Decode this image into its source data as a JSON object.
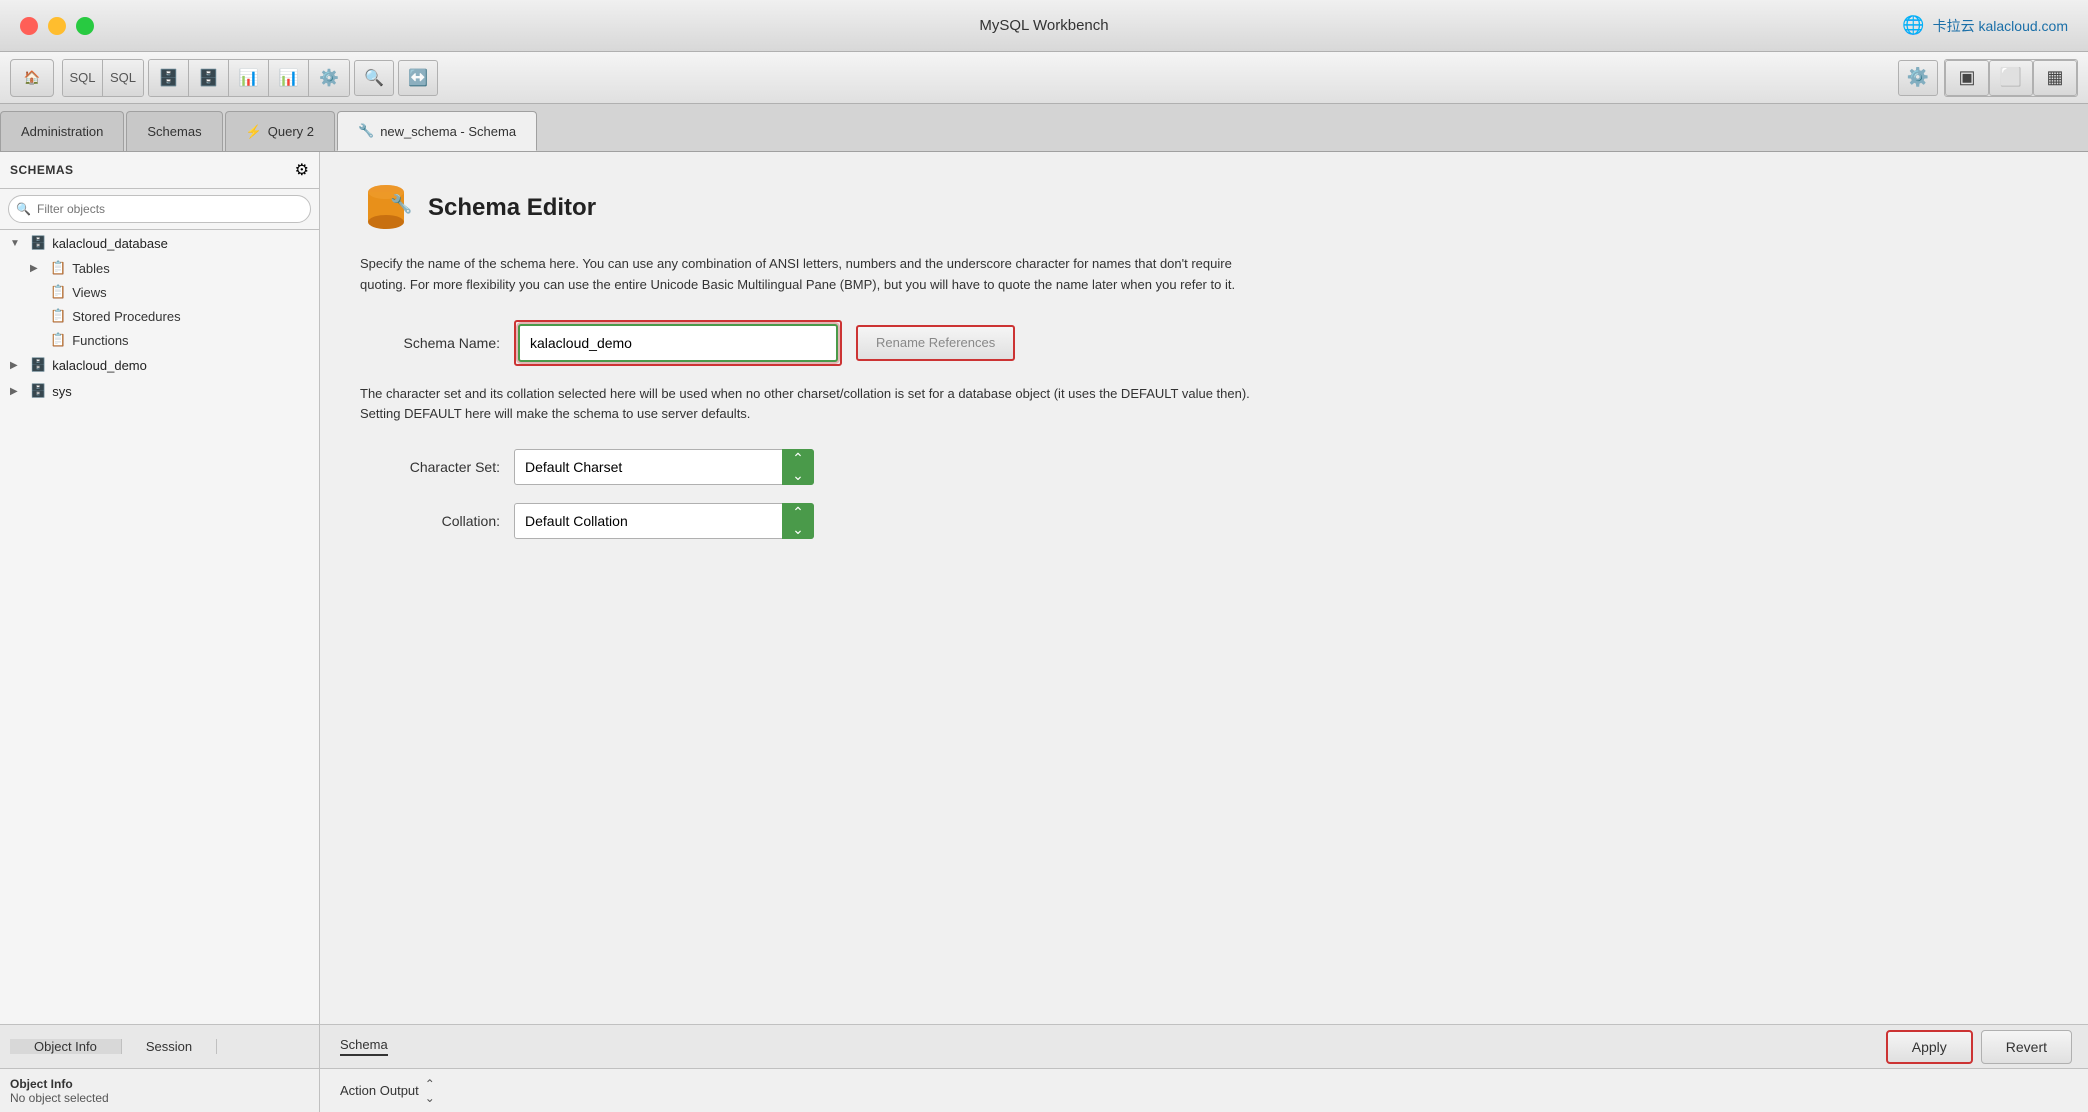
{
  "window": {
    "title": "MySQL Workbench",
    "brand": "卡拉云 kalacloud.com"
  },
  "tabs": {
    "items": [
      {
        "label": "Administration",
        "active": false
      },
      {
        "label": "Schemas",
        "active": false
      },
      {
        "label": "Query 2",
        "active": false,
        "icon": "⚡"
      },
      {
        "label": "new_schema - Schema",
        "active": true,
        "icon": "🔧"
      }
    ]
  },
  "sidebar": {
    "title": "SCHEMAS",
    "filter_placeholder": "Filter objects",
    "tree": [
      {
        "name": "kalacloud_database",
        "expanded": true,
        "children": [
          {
            "name": "Tables",
            "icon": "📋"
          },
          {
            "name": "Views",
            "icon": "📋"
          },
          {
            "name": "Stored Procedures",
            "icon": "📋"
          },
          {
            "name": "Functions",
            "icon": "📋"
          }
        ]
      },
      {
        "name": "kalacloud_demo",
        "expanded": false,
        "children": []
      },
      {
        "name": "sys",
        "expanded": false,
        "children": []
      }
    ]
  },
  "schema_editor": {
    "title": "Schema Editor",
    "description": "Specify the name of the schema here. You can use any combination of ANSI letters, numbers and the underscore character for names that don't require quoting. For more flexibility you can use the entire Unicode Basic Multilingual Pane (BMP), but you will have to quote the name later when you refer to it.",
    "charset_description": "The character set and its collation selected here will be used when no other charset/collation is set for a database object (it uses the DEFAULT value then). Setting DEFAULT here will make the schema to use server defaults.",
    "schema_name_label": "Schema Name:",
    "schema_name_value": "kalacloud_demo",
    "rename_btn_label": "Rename References",
    "charset_label": "Character Set:",
    "charset_value": "Default Charset",
    "collation_label": "Collation:",
    "collation_value": "Default Collation"
  },
  "bottom": {
    "tabs": [
      {
        "label": "Object Info",
        "active": true
      },
      {
        "label": "Session",
        "active": false
      }
    ],
    "schema_tab": "Schema",
    "apply_label": "Apply",
    "revert_label": "Revert",
    "no_object": "No object selected",
    "action_output_label": "Action Output"
  }
}
